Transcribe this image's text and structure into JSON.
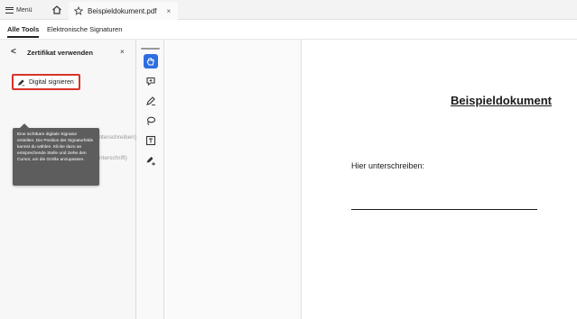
{
  "titlebar": {
    "menu_label": "Menü",
    "document_tab": "Beispieldokument.pdf",
    "close_glyph": "×",
    "icons": [
      "hamburger-icon",
      "home-icon",
      "star-icon",
      "close-icon"
    ]
  },
  "tools": {
    "tabs": [
      {
        "label": "Alle Tools",
        "active": true
      },
      {
        "label": "Elektronische Signaturen",
        "active": false
      }
    ]
  },
  "panel": {
    "back_glyph": "<",
    "title": "Zertifikat verwenden",
    "close_glyph": "×",
    "sign_button": "Digital signieren",
    "tooltip": "Eine sichtbare digitale Signatur erstellen. Die Position der Signaturfelds kannst du wählen. Klicke dazu an entsprechende Stelle und ziehe den Cursor, um die Größe anzupassen.",
    "partially_hidden_item": "Unterschreiben)",
    "certify_button": "Zertifizieren (unsichtbare Unterschrift)"
  },
  "vertical_toolbar": {
    "items": [
      {
        "icon": "hand-icon",
        "active": true
      },
      {
        "icon": "comment-icon",
        "active": false
      },
      {
        "icon": "pen-icon",
        "active": false
      },
      {
        "icon": "lasso-icon",
        "active": false
      },
      {
        "icon": "text-box-icon",
        "active": false
      },
      {
        "icon": "signature-icon",
        "active": false
      }
    ]
  },
  "document": {
    "title": "Beispieldokument",
    "sign_label": "Hier unterschreiben:"
  },
  "colors": {
    "accent_blue": "#2d6fe0",
    "highlight_red": "#d9342b",
    "tooltip_bg": "#5d5d5d"
  }
}
